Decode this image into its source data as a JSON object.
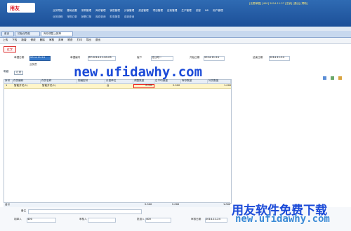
{
  "app": {
    "logo_text": "用友",
    "status_text": "[无限单据] [400] 2014-11-27 [注销] [退出] [帮助]"
  },
  "nav": {
    "primary": [
      "业务导航",
      "基础设置",
      "采购管理",
      "库存管理",
      "销售管理",
      "分销管理",
      "资金管理",
      "项目管理",
      "应收管理",
      "生产管理",
      "总账",
      "IMI",
      "用户管理"
    ],
    "secondary": [
      "业务流程",
      "采购订单",
      "销售订单",
      "库存查询",
      "财务报表",
      "应收查询"
    ]
  },
  "tabs": [
    "首页",
    "初始化导航",
    "库存调整上报单"
  ],
  "toolbar": [
    "上传",
    "下传",
    "新增",
    "修改",
    "删除",
    "审核",
    "弃审",
    "联查",
    "打印",
    "导出",
    "退出"
  ],
  "form_title": "红字",
  "form": {
    "date_label": "单据日期",
    "date_value": "2014-11-24",
    "doc_no_label": "单据编号",
    "doc_no_value": "RP-2014-11-00-03",
    "customer_label": "客户",
    "customer_value": "分公司一",
    "start_label": "开始日期",
    "start_value": "2014-11-24",
    "end_label": "结束日期",
    "end_value": "2014-11-24",
    "staff_label": "业务员"
  },
  "detail_tabs": [
    "明细",
    "汇总"
  ],
  "grid": {
    "headers": [
      "序号",
      "存货编码",
      "存货名称",
      "规格型号",
      "计量单位",
      "调整数量",
      "日平均销量",
      "库存数量",
      "补货数量"
    ],
    "rows": [
      [
        "1",
        "智能开关(1)",
        "智能开关(1)",
        "",
        "台",
        "2.000",
        "2.000",
        "",
        "1.000"
      ]
    ],
    "total_label": "合计",
    "totals": [
      "2.000",
      "2.000",
      "",
      "1.000"
    ]
  },
  "footer": {
    "remark_label": "备注",
    "maker_label": "制单人",
    "maker_value": "400",
    "checker_label": "审核人",
    "checker_value": "400",
    "check_date_label": "审核日期",
    "check_date_value": "2014-11-24",
    "approver_label": "批准人"
  },
  "watermark": {
    "url": "new.ufidawhy.com",
    "brand": "用友软件免费下载",
    "site": "new.ufidawhy.com"
  },
  "colors": {
    "topbar": "#1c4f98",
    "accent": "#e11111",
    "watermark": "#1b4ad8"
  }
}
